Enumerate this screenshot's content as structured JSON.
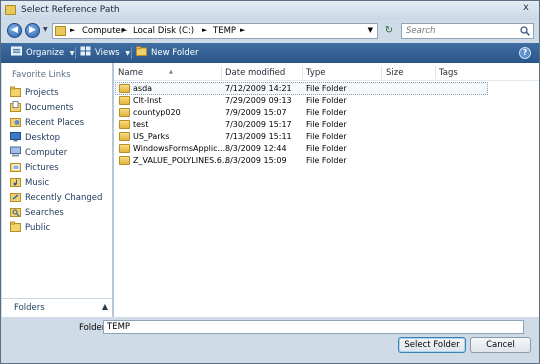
{
  "window": {
    "title": "Select Reference Path",
    "close_glyph": "x"
  },
  "address": {
    "crumbs": [
      "Computer",
      "Local Disk (C:)",
      "TEMP"
    ],
    "search_placeholder": "Search"
  },
  "toolbar": {
    "organize_label": "Organize",
    "views_label": "Views",
    "new_folder_label": "New Folder",
    "help_glyph": "?"
  },
  "nav": {
    "heading": "Favorite Links",
    "items": [
      {
        "label": "Projects",
        "icon": "folder-icon"
      },
      {
        "label": "Documents",
        "icon": "documents-icon"
      },
      {
        "label": "Recent Places",
        "icon": "recent-places-icon"
      },
      {
        "label": "Desktop",
        "icon": "desktop-icon"
      },
      {
        "label": "Computer",
        "icon": "computer-icon"
      },
      {
        "label": "Pictures",
        "icon": "pictures-icon"
      },
      {
        "label": "Music",
        "icon": "music-icon"
      },
      {
        "label": "Recently Changed",
        "icon": "recently-changed-icon"
      },
      {
        "label": "Searches",
        "icon": "searches-icon"
      },
      {
        "label": "Public",
        "icon": "public-icon"
      }
    ],
    "folders_label": "Folders"
  },
  "files": {
    "columns": [
      "Name",
      "Date modified",
      "Type",
      "Size",
      "Tags"
    ],
    "rows": [
      {
        "name": "asda",
        "date": "7/12/2009 14:21",
        "type": "File Folder",
        "size": ""
      },
      {
        "name": "Clt-Inst",
        "date": "7/29/2009 09:13",
        "type": "File Folder",
        "size": ""
      },
      {
        "name": "countyp020",
        "date": "7/9/2009 15:07",
        "type": "File Folder",
        "size": ""
      },
      {
        "name": "test",
        "date": "7/30/2009 15:17",
        "type": "File Folder",
        "size": ""
      },
      {
        "name": "US_Parks",
        "date": "7/13/2009 15:11",
        "type": "File Folder",
        "size": ""
      },
      {
        "name": "WindowsFormsApplic...",
        "date": "8/3/2009 12:44",
        "type": "File Folder",
        "size": ""
      },
      {
        "name": "Z_VALUE_POLYLINES.6...",
        "date": "8/3/2009 15:09",
        "type": "File Folder",
        "size": ""
      }
    ]
  },
  "footer": {
    "folder_label": "Folder:",
    "folder_value": "TEMP",
    "select_label": "Select Folder",
    "cancel_label": "Cancel"
  }
}
